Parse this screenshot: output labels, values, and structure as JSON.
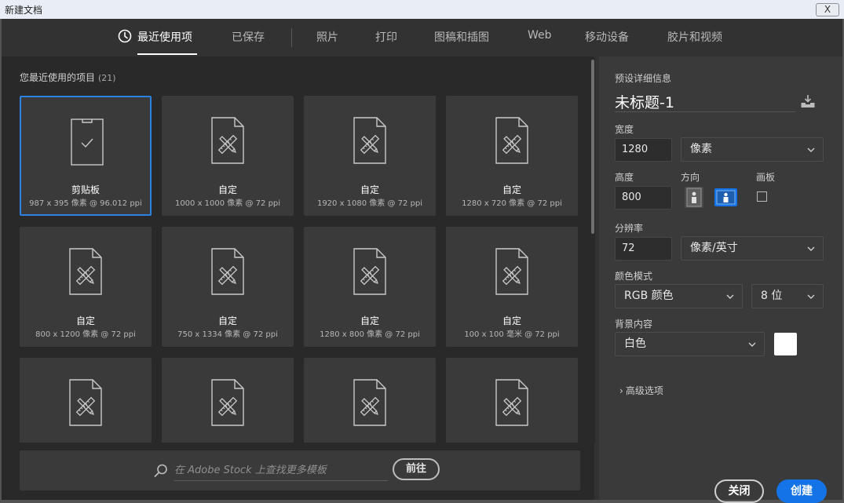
{
  "window": {
    "title": "新建文档",
    "close_label": "X"
  },
  "tabs": [
    {
      "label": "最近使用项",
      "active": true
    },
    {
      "label": "已保存"
    },
    {
      "label": "照片"
    },
    {
      "label": "打印"
    },
    {
      "label": "图稿和插图"
    },
    {
      "label": "Web"
    },
    {
      "label": "移动设备"
    },
    {
      "label": "胶片和视频"
    }
  ],
  "recent": {
    "heading": "您最近使用的项目",
    "count": "(21)",
    "items": [
      {
        "name": "剪贴板",
        "info": "987 x 395 像素 @ 96.012 ppi",
        "icon": "clipboard-icon",
        "selected": true
      },
      {
        "name": "自定",
        "info": "1000 x 1000 像素 @ 72 ppi",
        "icon": "document-ruler-icon"
      },
      {
        "name": "自定",
        "info": "1920 x 1080 像素 @ 72 ppi",
        "icon": "document-ruler-icon"
      },
      {
        "name": "自定",
        "info": "1280 x 720 像素 @ 72 ppi",
        "icon": "document-ruler-icon"
      },
      {
        "name": "自定",
        "info": "800 x 1200 像素 @ 72 ppi",
        "icon": "document-ruler-icon"
      },
      {
        "name": "自定",
        "info": "750 x 1334 像素 @ 72 ppi",
        "icon": "document-ruler-icon"
      },
      {
        "name": "自定",
        "info": "1280 x 800 像素 @ 72 ppi",
        "icon": "document-ruler-icon"
      },
      {
        "name": "自定",
        "info": "100 x 100 毫米 @ 72 ppi",
        "icon": "document-ruler-icon"
      },
      {
        "name": "",
        "info": "",
        "icon": "document-ruler-icon"
      },
      {
        "name": "",
        "info": "",
        "icon": "document-ruler-icon"
      },
      {
        "name": "",
        "info": "",
        "icon": "document-ruler-icon"
      },
      {
        "name": "",
        "info": "",
        "icon": "document-ruler-icon"
      }
    ]
  },
  "stock": {
    "placeholder": "在 Adobe Stock 上查找更多模板",
    "go_label": "前往"
  },
  "preset": {
    "section_label": "预设详细信息",
    "doc_name": "未标题-1",
    "width_label": "宽度",
    "width_value": "1280",
    "width_unit": "像素",
    "height_label": "高度",
    "height_value": "800",
    "orientation_label": "方向",
    "orientation_selected": "landscape",
    "artboard_label": "画板",
    "artboard_checked": false,
    "resolution_label": "分辨率",
    "resolution_value": "72",
    "resolution_unit": "像素/英寸",
    "color_mode_label": "颜色模式",
    "color_mode_value": "RGB 颜色",
    "bit_depth_value": "8 位",
    "background_label": "背景内容",
    "background_value": "白色",
    "background_swatch": "#ffffff",
    "advanced_label": "高级选项"
  },
  "actions": {
    "close_label": "关闭",
    "create_label": "创建"
  },
  "colors": {
    "accent": "#1473e6",
    "selection_border": "#2c82e0"
  }
}
